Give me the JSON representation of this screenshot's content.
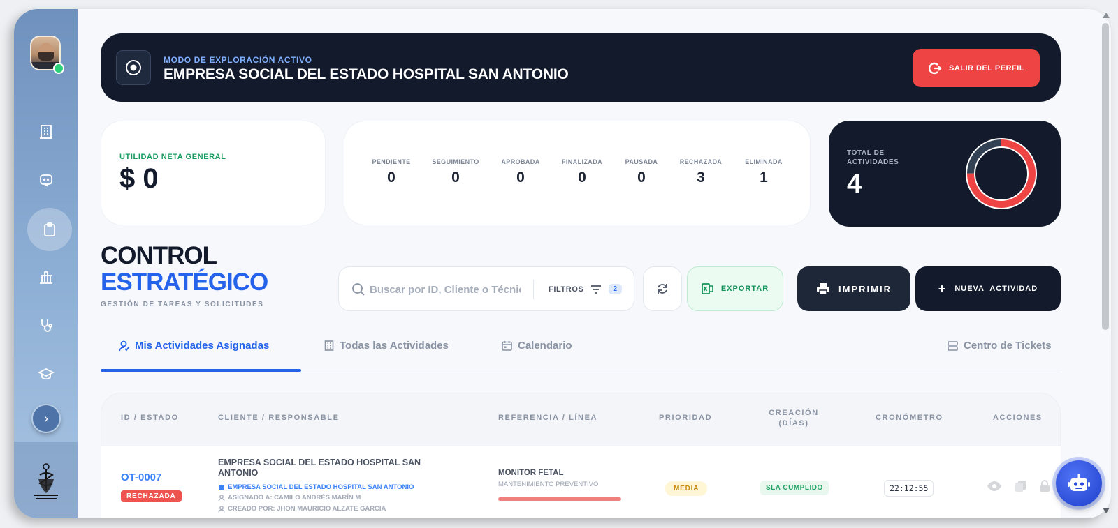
{
  "sidebar": {
    "icons": [
      "building-icon",
      "chat-bot-icon",
      "clipboard-icon",
      "bank-icon",
      "stethoscope-icon",
      "graduation-cap-icon"
    ],
    "expand_icon": "chevron-right-icon",
    "user_status_color": "#2fd07a"
  },
  "banner": {
    "kicker": "MODO DE EXPLORACIÓN ACTIVO",
    "title": "EMPRESA SOCIAL DEL ESTADO HOSPITAL SAN ANTONIO",
    "exit_label": "SALIR DEL PERFIL"
  },
  "net_card": {
    "label": "UTILIDAD NETA GENERAL",
    "value": "$ 0"
  },
  "status_counts": [
    {
      "label": "PENDIENTE",
      "value": "0"
    },
    {
      "label": "SEGUIMIENTO",
      "value": "0"
    },
    {
      "label": "APROBADA",
      "value": "0"
    },
    {
      "label": "FINALIZADA",
      "value": "0"
    },
    {
      "label": "PAUSADA",
      "value": "0"
    },
    {
      "label": "RECHAZADA",
      "value": "3"
    },
    {
      "label": "ELIMINADA",
      "value": "1"
    }
  ],
  "total_card": {
    "label": "TOTAL DE ACTIVIDADES",
    "value": "4",
    "donut": {
      "rechazada": 3,
      "eliminada": 1,
      "colors": {
        "rechazada": "#ef4444",
        "eliminada": "#334155"
      }
    }
  },
  "page_header": {
    "title_line1": "CONTROL",
    "title_line2": "ESTRATÉGICO",
    "subtitle": "GESTIÓN DE TAREAS Y SOLICITUDES"
  },
  "toolbar": {
    "search_placeholder": "Buscar por ID, Cliente o Técnico",
    "filters_label": "FILTROS",
    "filters_count": "2",
    "export_label": "EXPORTAR",
    "print_label": "IMPRIMIR",
    "new_label": "NUEVA  ACTIVIDAD"
  },
  "tabs": [
    {
      "label": "Mis Actividades Asignadas",
      "active": true
    },
    {
      "label": "Todas las Actividades",
      "active": false
    },
    {
      "label": "Calendario",
      "active": false
    },
    {
      "label": "Centro de Tickets",
      "active": false
    }
  ],
  "table": {
    "headers": [
      "ID / ESTADO",
      "CLIENTE / RESPONSABLE",
      "REFERENCIA / LÍNEA",
      "PRIORIDAD",
      "CREACIÓN (DÍAS)",
      "CRONÓMETRO",
      "ACCIONES"
    ],
    "rows": [
      {
        "id": "OT-0007",
        "status": "RECHAZADA",
        "client": "EMPRESA SOCIAL DEL ESTADO HOSPITAL SAN ANTONIO",
        "client_tag": "EMPRESA SOCIAL DEL ESTADO HOSPITAL SAN ANTONIO",
        "assigned": "ASIGNADO A: CAMILO ANDRÉS MARÍN M",
        "created_by": "CREADO POR: JHON MAURICIO ALZATE GARCIA",
        "reference": "MONITOR FETAL",
        "line": "MANTENIMIENTO PREVENTIVO",
        "priority": "MEDIA",
        "creation": "SLA CUMPLIDO",
        "timer": "22:12:55"
      }
    ]
  }
}
